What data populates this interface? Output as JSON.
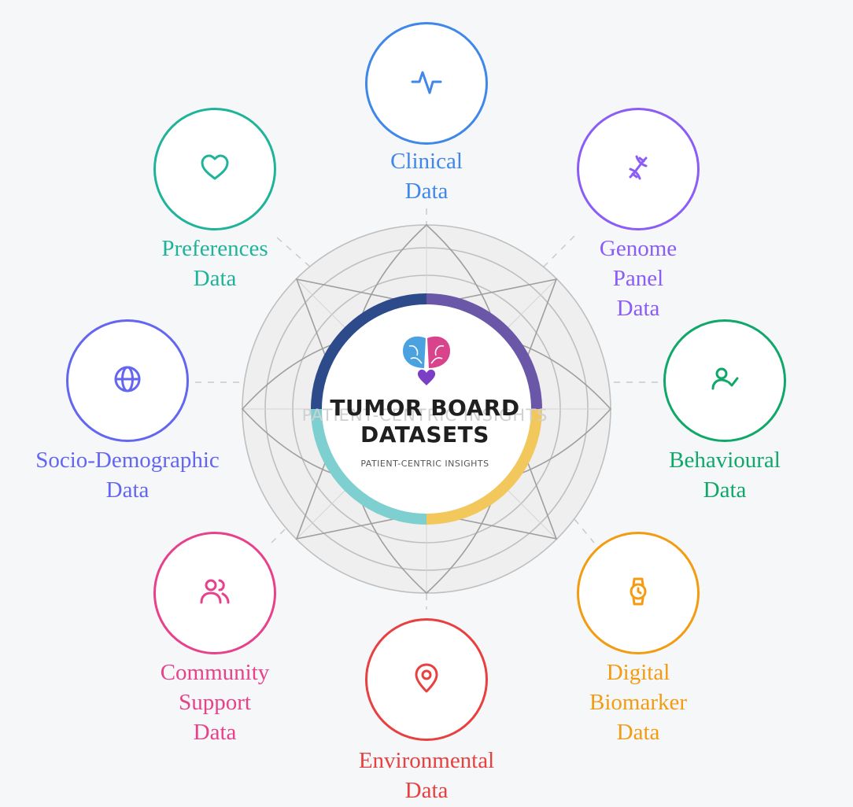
{
  "hub": {
    "title": "TUMOR BOARD\nDATASETS",
    "subtitle": "PATIENT-CENTRIC INSIGHTS",
    "watermark": "PATIENT-CENTRIC INSIGHTS",
    "ring_colors": [
      "#6b57a8",
      "#f2c75c",
      "#7ecfcf",
      "#2d4a8a"
    ]
  },
  "nodes": [
    {
      "id": "clinical",
      "label": "Clinical\nData",
      "color": "#3f87e8",
      "icon": "pulse-icon"
    },
    {
      "id": "genome",
      "label": "Genome\nPanel\nData",
      "color": "#8b5cf6",
      "icon": "dna-icon"
    },
    {
      "id": "behavioural",
      "label": "Behavioural\nData",
      "color": "#10a86a",
      "icon": "user-check-icon"
    },
    {
      "id": "digital-biomarker",
      "label": "Digital\nBiomarker\nData",
      "color": "#f39c12",
      "icon": "watch-icon"
    },
    {
      "id": "environmental",
      "label": "Environmental\nData",
      "color": "#e84040",
      "icon": "map-pin-icon"
    },
    {
      "id": "community-support",
      "label": "Community\nSupport\nData",
      "color": "#e8418c",
      "icon": "users-icon"
    },
    {
      "id": "socio-demographic",
      "label": "Socio-Demographic\nData",
      "color": "#6366f1",
      "icon": "globe-icon"
    },
    {
      "id": "preferences",
      "label": "Preferences\nData",
      "color": "#1fb39a",
      "icon": "heart-icon"
    }
  ]
}
